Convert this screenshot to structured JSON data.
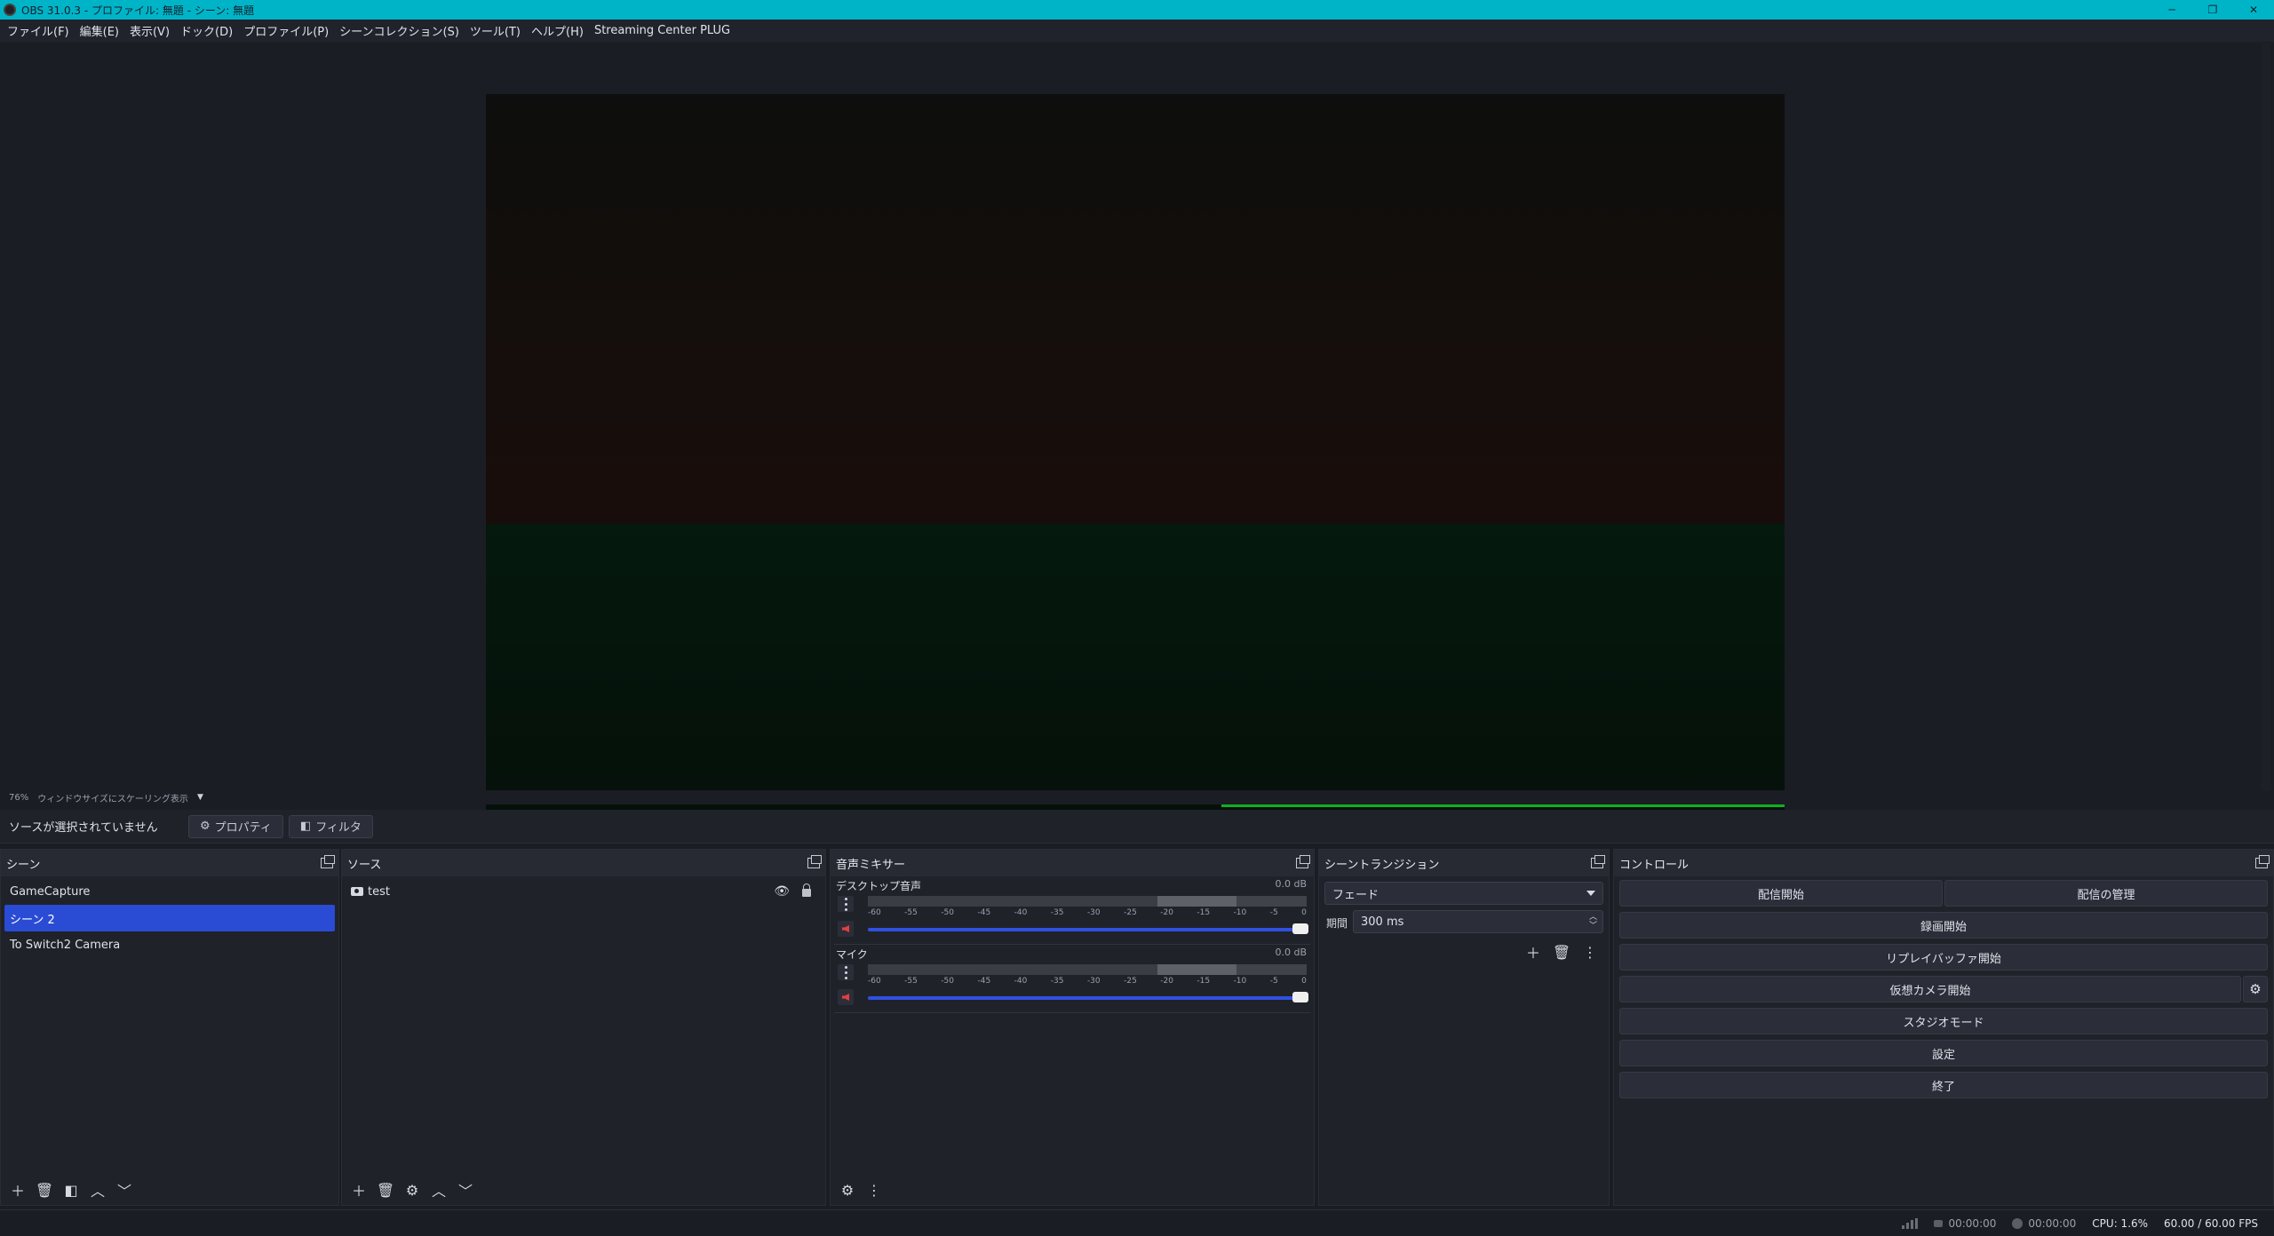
{
  "window": {
    "title": "OBS 31.0.3 - プロファイル: 無題 - シーン: 無題",
    "controls": [
      "─",
      "❐",
      "✕"
    ]
  },
  "menu": [
    "ファイル(F)",
    "編集(E)",
    "表示(V)",
    "ドック(D)",
    "プロファイル(P)",
    "シーンコレクション(S)",
    "ツール(T)",
    "ヘルプ(H)",
    "Streaming Center PLUG"
  ],
  "preview": {
    "zoom": "76%",
    "scale_mode": "ウィンドウサイズにスケーリング表示"
  },
  "context": {
    "no_source": "ソースが選択されていません",
    "properties": "プロパティ",
    "filters": "フィルタ"
  },
  "scenes": {
    "title": "シーン",
    "items": [
      "GameCapture",
      "シーン 2",
      "To Switch2 Camera"
    ],
    "selected_index": 1
  },
  "sources": {
    "title": "ソース",
    "items": [
      {
        "name": "test",
        "type": "camera-icon"
      }
    ]
  },
  "mixer": {
    "title": "音声ミキサー",
    "channels": [
      {
        "name": "デスクトップ音声",
        "db": "0.0 dB",
        "muted": true,
        "volume": 1.0
      },
      {
        "name": "マイク",
        "db": "0.0 dB",
        "muted": true,
        "volume": 1.0
      }
    ],
    "ticks": [
      "-60",
      "-55",
      "-50",
      "-45",
      "-40",
      "-35",
      "-30",
      "-25",
      "-20",
      "-15",
      "-10",
      "-5",
      "0"
    ]
  },
  "transitions": {
    "title": "シーントランジション",
    "selected": "フェード",
    "duration_label": "期間",
    "duration": "300 ms"
  },
  "controls": {
    "title": "コントロール",
    "start_stream": "配信開始",
    "manage_stream": "配信の管理",
    "start_record": "録画開始",
    "start_replay": "リプレイバッファ開始",
    "start_vcam": "仮想カメラ開始",
    "studio_mode": "スタジオモード",
    "settings": "設定",
    "exit": "終了"
  },
  "status": {
    "stream_time": "00:00:00",
    "record_time": "00:00:00",
    "cpu": "CPU: 1.6%",
    "fps": "60.00 / 60.00 FPS"
  },
  "colors": {
    "titlebar": "#00b4c8",
    "selection": "#2a4bd4",
    "signal_green": "#10b020"
  }
}
